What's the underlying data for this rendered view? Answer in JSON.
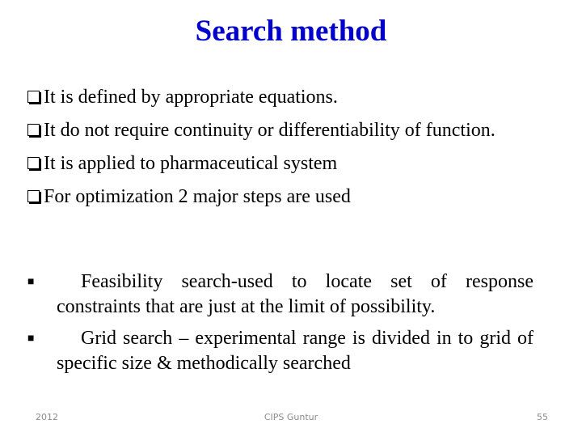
{
  "slide": {
    "title": "Search method",
    "bullets": [
      "It is defined by appropriate equations.",
      "It do not require continuity or differentiability of function.",
      "It is applied to pharmaceutical system",
      "For optimization 2 major steps are used"
    ],
    "sub_bullets": [
      "Feasibility search-used to locate set of response constraints that are just at the limit of possibility.",
      "Grid search – experimental range is divided in to grid of specific size & methodically searched"
    ],
    "title_color": "#0000cc"
  },
  "footer": {
    "left": "2012",
    "center": "CIPS Guntur",
    "right": "55"
  }
}
